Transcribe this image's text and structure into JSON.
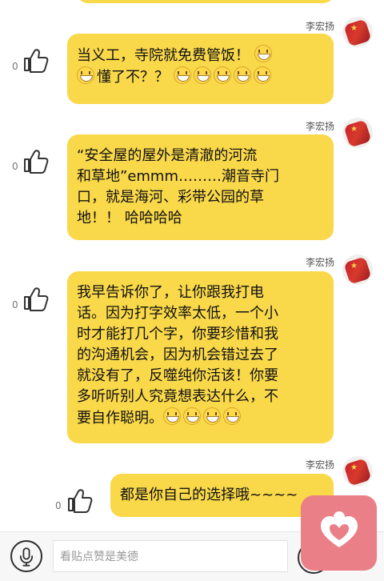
{
  "chat": {
    "sender_name": "李宏扬",
    "messages": [
      {
        "lines": [
          "当义工，寺院就免费管饭！",
          "懂了不？？"
        ],
        "like_count": "0"
      },
      {
        "lines": [
          "“安全屋的屋外是清澈的河流",
          "和草地”emmm………潮音寺门",
          "口，就是海河、彩带公园的草",
          "地！！ 哈哈哈哈"
        ],
        "like_count": "0"
      },
      {
        "lines": [
          "我早告诉你了，让你跟我打电",
          "话。因为打字效率太低，一个小",
          "时才能打几个字，你要珍惜和我",
          "的沟通机会，因为机会错过去了",
          "就没有了，反噬纯你活该！你要",
          "多听听别人究竟想表达什么，不",
          "要自作聪明。"
        ],
        "like_count": "0"
      },
      {
        "lines": [
          "都是你自己的选择哦~~~~"
        ],
        "like_count": "0"
      }
    ]
  },
  "composer": {
    "placeholder": "看贴点赞是美德"
  },
  "colors": {
    "bubble": "#f9d84a",
    "favorite": "#ea7f87"
  },
  "icons": {
    "like": "thumbs-up-icon",
    "voice": "microphone-icon",
    "favorite": "heart-icon"
  }
}
